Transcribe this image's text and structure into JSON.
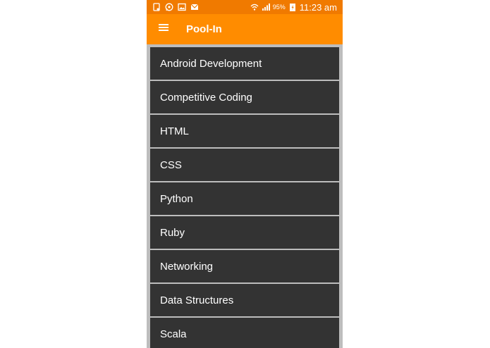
{
  "status_bar": {
    "left_icons": [
      "notification-icon",
      "whatsapp-icon",
      "image-icon",
      "mail-icon"
    ],
    "battery_percent": "95%",
    "time": "11:23 am"
  },
  "app_bar": {
    "title": "Pool-In",
    "menu_icon": "hamburger-menu-icon"
  },
  "topics": [
    {
      "label": "Android Development"
    },
    {
      "label": "Competitive Coding"
    },
    {
      "label": "HTML"
    },
    {
      "label": "CSS"
    },
    {
      "label": "Python"
    },
    {
      "label": "Ruby"
    },
    {
      "label": "Networking"
    },
    {
      "label": "Data Structures"
    },
    {
      "label": "Scala"
    }
  ],
  "colors": {
    "status_bar": "#f07a00",
    "app_bar": "#ff8c00",
    "list_item_bg": "#333333",
    "list_background": "#bdbdbd",
    "text": "#ffffff"
  }
}
